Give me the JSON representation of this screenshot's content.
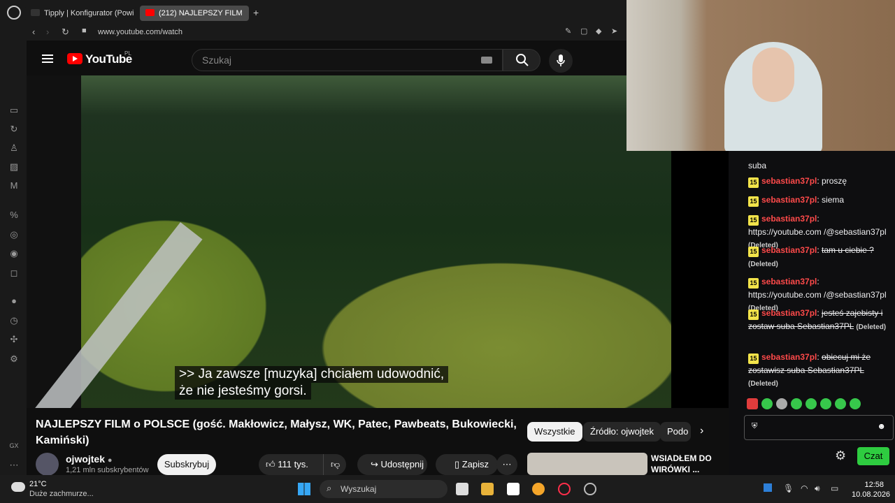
{
  "browser": {
    "tabs": [
      {
        "label": "Tipply | Konfigurator (Powi",
        "favicon": "tipply-icon"
      },
      {
        "label": "(212) NAJLEPSZY FILM",
        "favicon": "youtube-icon"
      }
    ],
    "url": "www.youtube.com/watch"
  },
  "youtube": {
    "logo_text": "YouTube",
    "region": "PL",
    "search_placeholder": "Szukaj"
  },
  "video": {
    "subtitle_line1": ">> Ja zawsze [muzyka] chciałem udowodnić,",
    "subtitle_line2": "że nie jesteśmy gorsi.",
    "title": "NAJLEPSZY FILM o POLSCE (gość. Makłowicz, Małysz, WK, Patec, Pawbeats, Bukowiecki, Kamiński)",
    "channel": "ojwojtek",
    "subscribers": "1,21 mln subskrybentów",
    "subscribe_label": "Subskrybuj",
    "likes": "111 tys.",
    "share_label": "Udostępnij",
    "save_label": "Zapisz"
  },
  "related": {
    "chips": [
      "Wszystkie",
      "Źródło: ojwojtek",
      "Podo"
    ],
    "first_title_line1": "WSIADŁEM DO",
    "first_title_line2": "WIRÓWKI ..."
  },
  "chat": {
    "top_partial": "suba",
    "badge": "15",
    "messages": [
      {
        "user": "sebastian37pl",
        "text": "proszę",
        "deleted": ""
      },
      {
        "user": "sebastian37pl",
        "text": "siema",
        "deleted": ""
      },
      {
        "user": "sebastian37pl",
        "text": "https://youtube.com /@sebastian37pl",
        "deleted": "(Deleted)"
      },
      {
        "user": "sebastian37pl",
        "text": "tam u ciebie ?",
        "deleted": "(Deleted)"
      },
      {
        "user": "sebastian37pl",
        "text": "https://youtube.com /@sebastian37pl",
        "deleted": "(Deleted)"
      },
      {
        "user": "sebastian37pl",
        "text": "jesteś zajebisty i zostaw suba Sebastian37PL",
        "deleted": "(Deleted)"
      },
      {
        "user": "sebastian37pl",
        "text": "obiecuj mi że zostawisz suba Sebastian37PL",
        "deleted": "(Deleted)"
      }
    ],
    "send_label": "Czat"
  },
  "taskbar": {
    "temperature": "21°C",
    "weather": "Duże zachmurze...",
    "search_label": "Wyszukaj",
    "time": "12:58",
    "date": "10.08.2026"
  },
  "colors": {
    "yt_red": "#ff0000",
    "chat_user": "#ff4a4a",
    "czat_green": "#2ecc40",
    "badge_yellow": "#f2e34a"
  }
}
